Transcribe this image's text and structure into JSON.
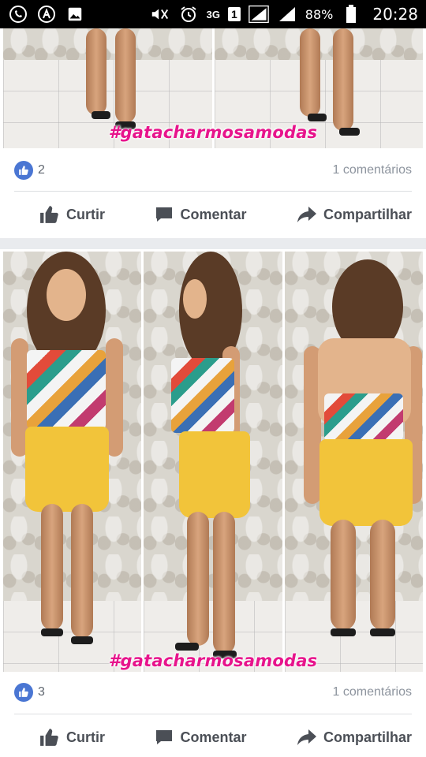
{
  "status_bar": {
    "battery_percent": "88%",
    "time": "20:28",
    "network_label": "3G",
    "sim_slot": "1",
    "icons": [
      "whatsapp-icon",
      "app-notification-icon",
      "image-icon",
      "mute-icon",
      "alarm-icon",
      "signal-icon",
      "battery-icon"
    ]
  },
  "posts": [
    {
      "hashtag": "#gatacharmosamodas",
      "likes": "2",
      "comments": "1 comentários",
      "actions": {
        "like": "Curtir",
        "comment": "Comentar",
        "share": "Compartilhar"
      }
    },
    {
      "hashtag": "#gatacharmosamodas",
      "likes": "3",
      "comments": "1 comentários",
      "actions": {
        "like": "Curtir",
        "comment": "Comentar",
        "share": "Compartilhar"
      }
    }
  ],
  "colors": {
    "like_badge": "#4a76d3",
    "hashtag": "#e7148c",
    "feed_bg": "#e9ebee",
    "shorts": "#f2c43a"
  }
}
